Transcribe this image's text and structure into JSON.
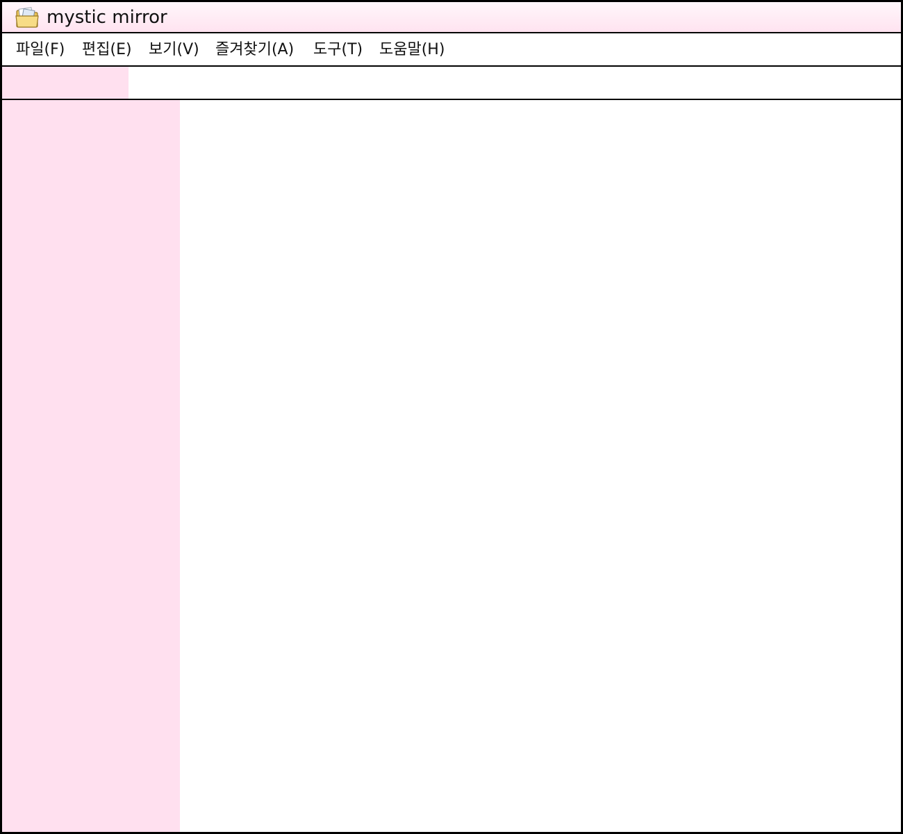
{
  "window": {
    "title": "mystic mirror",
    "icon": "folder-icon"
  },
  "menubar": {
    "items": [
      {
        "label": "파일(F)"
      },
      {
        "label": "편집(E)"
      },
      {
        "label": "보기(V)"
      },
      {
        "label": "즐겨찾기(A)"
      },
      {
        "label": "도구(T)"
      },
      {
        "label": "도움말(H)"
      }
    ]
  },
  "colors": {
    "accent_pink": "#ffe0ef",
    "border": "#000000",
    "background": "#ffffff"
  }
}
